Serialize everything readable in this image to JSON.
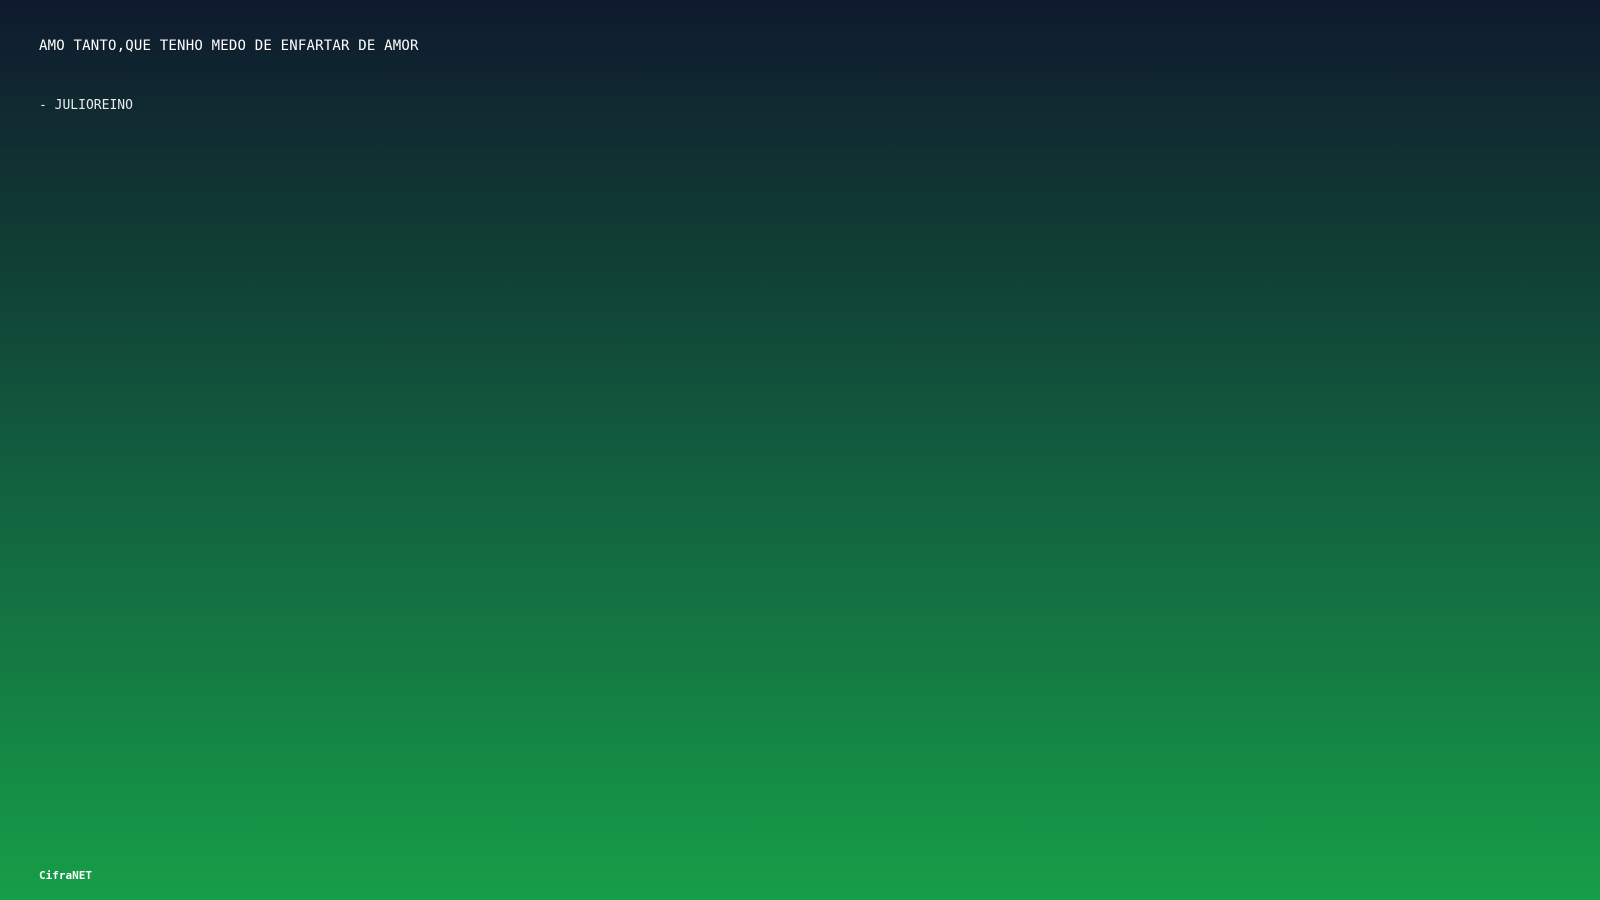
{
  "quote": {
    "text": "AMO TANTO,QUE TENHO MEDO DE ENFARTAR DE AMOR",
    "author": "- JULIOREINO"
  },
  "footer": {
    "brand": "CifraNET"
  },
  "colors": {
    "gradient_top": "#0f1a2e",
    "gradient_bottom": "#169e48",
    "text": "#ffffff"
  }
}
